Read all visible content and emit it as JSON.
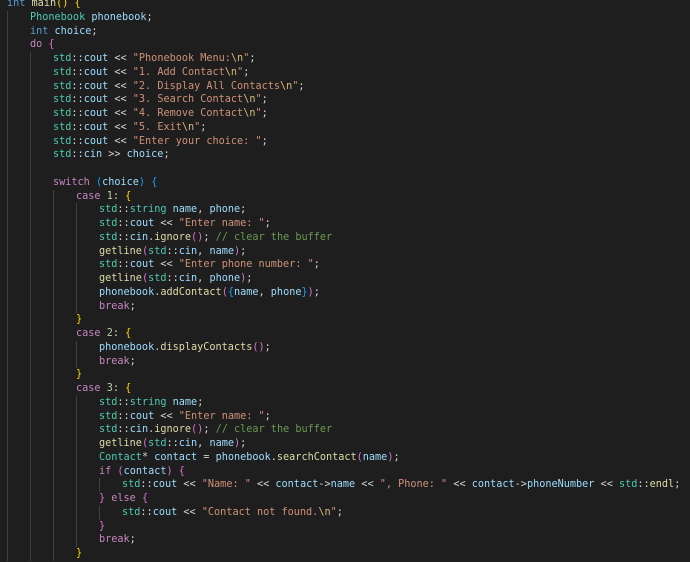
{
  "editor": {
    "language": "cpp",
    "theme": "dark",
    "lines": [
      {
        "indent": 0,
        "tokens": [
          [
            "int",
            "keyword"
          ],
          [
            " ",
            "plain"
          ],
          [
            "main",
            "func"
          ],
          [
            "()",
            "brace1"
          ],
          [
            " ",
            "plain"
          ],
          [
            "{",
            "brace1"
          ]
        ]
      },
      {
        "indent": 1,
        "tokens": [
          [
            "Phonebook",
            "type"
          ],
          [
            " ",
            "plain"
          ],
          [
            "phonebook",
            "var"
          ],
          [
            ";",
            "plain"
          ]
        ]
      },
      {
        "indent": 1,
        "tokens": [
          [
            "int",
            "keyword"
          ],
          [
            " ",
            "plain"
          ],
          [
            "choice",
            "var"
          ],
          [
            ";",
            "plain"
          ]
        ]
      },
      {
        "indent": 1,
        "tokens": [
          [
            "do",
            "control"
          ],
          [
            " ",
            "plain"
          ],
          [
            "{",
            "brace2"
          ]
        ]
      },
      {
        "indent": 2,
        "tokens": [
          [
            "std",
            "type"
          ],
          [
            "::",
            "op"
          ],
          [
            "cout",
            "var"
          ],
          [
            " << ",
            "op"
          ],
          [
            "\"Phonebook Menu:",
            "string"
          ],
          [
            "\\n",
            "escape"
          ],
          [
            "\"",
            "string"
          ],
          [
            ";",
            "plain"
          ]
        ]
      },
      {
        "indent": 2,
        "tokens": [
          [
            "std",
            "type"
          ],
          [
            "::",
            "op"
          ],
          [
            "cout",
            "var"
          ],
          [
            " << ",
            "op"
          ],
          [
            "\"1. Add Contact",
            "string"
          ],
          [
            "\\n",
            "escape"
          ],
          [
            "\"",
            "string"
          ],
          [
            ";",
            "plain"
          ]
        ]
      },
      {
        "indent": 2,
        "tokens": [
          [
            "std",
            "type"
          ],
          [
            "::",
            "op"
          ],
          [
            "cout",
            "var"
          ],
          [
            " << ",
            "op"
          ],
          [
            "\"2. Display All Contacts",
            "string"
          ],
          [
            "\\n",
            "escape"
          ],
          [
            "\"",
            "string"
          ],
          [
            ";",
            "plain"
          ]
        ]
      },
      {
        "indent": 2,
        "tokens": [
          [
            "std",
            "type"
          ],
          [
            "::",
            "op"
          ],
          [
            "cout",
            "var"
          ],
          [
            " << ",
            "op"
          ],
          [
            "\"3. Search Contact",
            "string"
          ],
          [
            "\\n",
            "escape"
          ],
          [
            "\"",
            "string"
          ],
          [
            ";",
            "plain"
          ]
        ]
      },
      {
        "indent": 2,
        "tokens": [
          [
            "std",
            "type"
          ],
          [
            "::",
            "op"
          ],
          [
            "cout",
            "var"
          ],
          [
            " << ",
            "op"
          ],
          [
            "\"4. Remove Contact",
            "string"
          ],
          [
            "\\n",
            "escape"
          ],
          [
            "\"",
            "string"
          ],
          [
            ";",
            "plain"
          ]
        ]
      },
      {
        "indent": 2,
        "tokens": [
          [
            "std",
            "type"
          ],
          [
            "::",
            "op"
          ],
          [
            "cout",
            "var"
          ],
          [
            " << ",
            "op"
          ],
          [
            "\"5. Exit",
            "string"
          ],
          [
            "\\n",
            "escape"
          ],
          [
            "\"",
            "string"
          ],
          [
            ";",
            "plain"
          ]
        ]
      },
      {
        "indent": 2,
        "tokens": [
          [
            "std",
            "type"
          ],
          [
            "::",
            "op"
          ],
          [
            "cout",
            "var"
          ],
          [
            " << ",
            "op"
          ],
          [
            "\"Enter your choice: \"",
            "string"
          ],
          [
            ";",
            "plain"
          ]
        ]
      },
      {
        "indent": 2,
        "tokens": [
          [
            "std",
            "type"
          ],
          [
            "::",
            "op"
          ],
          [
            "cin",
            "var"
          ],
          [
            " >> ",
            "op"
          ],
          [
            "choice",
            "var"
          ],
          [
            ";",
            "plain"
          ]
        ]
      },
      {
        "indent": 2,
        "tokens": []
      },
      {
        "indent": 2,
        "tokens": [
          [
            "switch",
            "control"
          ],
          [
            " ",
            "plain"
          ],
          [
            "(",
            "brace3"
          ],
          [
            "choice",
            "var"
          ],
          [
            ")",
            "brace3"
          ],
          [
            " ",
            "plain"
          ],
          [
            "{",
            "brace3"
          ]
        ]
      },
      {
        "indent": 3,
        "tokens": [
          [
            "case",
            "control"
          ],
          [
            " ",
            "plain"
          ],
          [
            "1",
            "number"
          ],
          [
            ":",
            "plain"
          ],
          [
            " ",
            "plain"
          ],
          [
            "{",
            "brace1"
          ]
        ]
      },
      {
        "indent": 4,
        "tokens": [
          [
            "std",
            "type"
          ],
          [
            "::",
            "op"
          ],
          [
            "string",
            "type"
          ],
          [
            " ",
            "plain"
          ],
          [
            "name",
            "var"
          ],
          [
            ", ",
            "plain"
          ],
          [
            "phone",
            "var"
          ],
          [
            ";",
            "plain"
          ]
        ]
      },
      {
        "indent": 4,
        "tokens": [
          [
            "std",
            "type"
          ],
          [
            "::",
            "op"
          ],
          [
            "cout",
            "var"
          ],
          [
            " << ",
            "op"
          ],
          [
            "\"Enter name: \"",
            "string"
          ],
          [
            ";",
            "plain"
          ]
        ]
      },
      {
        "indent": 4,
        "tokens": [
          [
            "std",
            "type"
          ],
          [
            "::",
            "op"
          ],
          [
            "cin",
            "var"
          ],
          [
            ".",
            "plain"
          ],
          [
            "ignore",
            "func"
          ],
          [
            "()",
            "brace2"
          ],
          [
            ";",
            "plain"
          ],
          [
            " ",
            "plain"
          ],
          [
            "// clear the buffer",
            "comment"
          ]
        ]
      },
      {
        "indent": 4,
        "tokens": [
          [
            "getline",
            "func"
          ],
          [
            "(",
            "brace2"
          ],
          [
            "std",
            "type"
          ],
          [
            "::",
            "op"
          ],
          [
            "cin",
            "var"
          ],
          [
            ", ",
            "plain"
          ],
          [
            "name",
            "var"
          ],
          [
            ")",
            "brace2"
          ],
          [
            ";",
            "plain"
          ]
        ]
      },
      {
        "indent": 4,
        "tokens": [
          [
            "std",
            "type"
          ],
          [
            "::",
            "op"
          ],
          [
            "cout",
            "var"
          ],
          [
            " << ",
            "op"
          ],
          [
            "\"Enter phone number: \"",
            "string"
          ],
          [
            ";",
            "plain"
          ]
        ]
      },
      {
        "indent": 4,
        "tokens": [
          [
            "getline",
            "func"
          ],
          [
            "(",
            "brace2"
          ],
          [
            "std",
            "type"
          ],
          [
            "::",
            "op"
          ],
          [
            "cin",
            "var"
          ],
          [
            ", ",
            "plain"
          ],
          [
            "phone",
            "var"
          ],
          [
            ")",
            "brace2"
          ],
          [
            ";",
            "plain"
          ]
        ]
      },
      {
        "indent": 4,
        "tokens": [
          [
            "phonebook",
            "var"
          ],
          [
            ".",
            "plain"
          ],
          [
            "addContact",
            "func"
          ],
          [
            "(",
            "brace2"
          ],
          [
            "{",
            "brace3"
          ],
          [
            "name",
            "var"
          ],
          [
            ", ",
            "plain"
          ],
          [
            "phone",
            "var"
          ],
          [
            "}",
            "brace3"
          ],
          [
            ")",
            "brace2"
          ],
          [
            ";",
            "plain"
          ]
        ]
      },
      {
        "indent": 4,
        "tokens": [
          [
            "break",
            "control"
          ],
          [
            ";",
            "plain"
          ]
        ]
      },
      {
        "indent": 3,
        "tokens": [
          [
            "}",
            "brace1"
          ]
        ]
      },
      {
        "indent": 3,
        "tokens": [
          [
            "case",
            "control"
          ],
          [
            " ",
            "plain"
          ],
          [
            "2",
            "number"
          ],
          [
            ":",
            "plain"
          ],
          [
            " ",
            "plain"
          ],
          [
            "{",
            "brace1"
          ]
        ]
      },
      {
        "indent": 4,
        "tokens": [
          [
            "phonebook",
            "var"
          ],
          [
            ".",
            "plain"
          ],
          [
            "displayContacts",
            "func"
          ],
          [
            "()",
            "brace2"
          ],
          [
            ";",
            "plain"
          ]
        ]
      },
      {
        "indent": 4,
        "tokens": [
          [
            "break",
            "control"
          ],
          [
            ";",
            "plain"
          ]
        ]
      },
      {
        "indent": 3,
        "tokens": [
          [
            "}",
            "brace1"
          ]
        ]
      },
      {
        "indent": 3,
        "tokens": [
          [
            "case",
            "control"
          ],
          [
            " ",
            "plain"
          ],
          [
            "3",
            "number"
          ],
          [
            ":",
            "plain"
          ],
          [
            " ",
            "plain"
          ],
          [
            "{",
            "brace1"
          ]
        ]
      },
      {
        "indent": 4,
        "tokens": [
          [
            "std",
            "type"
          ],
          [
            "::",
            "op"
          ],
          [
            "string",
            "type"
          ],
          [
            " ",
            "plain"
          ],
          [
            "name",
            "var"
          ],
          [
            ";",
            "plain"
          ]
        ]
      },
      {
        "indent": 4,
        "tokens": [
          [
            "std",
            "type"
          ],
          [
            "::",
            "op"
          ],
          [
            "cout",
            "var"
          ],
          [
            " << ",
            "op"
          ],
          [
            "\"Enter name: \"",
            "string"
          ],
          [
            ";",
            "plain"
          ]
        ]
      },
      {
        "indent": 4,
        "tokens": [
          [
            "std",
            "type"
          ],
          [
            "::",
            "op"
          ],
          [
            "cin",
            "var"
          ],
          [
            ".",
            "plain"
          ],
          [
            "ignore",
            "func"
          ],
          [
            "()",
            "brace2"
          ],
          [
            ";",
            "plain"
          ],
          [
            " ",
            "plain"
          ],
          [
            "// clear the buffer",
            "comment"
          ]
        ]
      },
      {
        "indent": 4,
        "tokens": [
          [
            "getline",
            "func"
          ],
          [
            "(",
            "brace2"
          ],
          [
            "std",
            "type"
          ],
          [
            "::",
            "op"
          ],
          [
            "cin",
            "var"
          ],
          [
            ", ",
            "plain"
          ],
          [
            "name",
            "var"
          ],
          [
            ")",
            "brace2"
          ],
          [
            ";",
            "plain"
          ]
        ]
      },
      {
        "indent": 4,
        "tokens": [
          [
            "Contact",
            "type"
          ],
          [
            "* ",
            "plain"
          ],
          [
            "contact",
            "var"
          ],
          [
            " = ",
            "op"
          ],
          [
            "phonebook",
            "var"
          ],
          [
            ".",
            "plain"
          ],
          [
            "searchContact",
            "func"
          ],
          [
            "(",
            "brace2"
          ],
          [
            "name",
            "var"
          ],
          [
            ")",
            "brace2"
          ],
          [
            ";",
            "plain"
          ]
        ]
      },
      {
        "indent": 4,
        "tokens": [
          [
            "if",
            "control"
          ],
          [
            " ",
            "plain"
          ],
          [
            "(",
            "brace2"
          ],
          [
            "contact",
            "var"
          ],
          [
            ")",
            "brace2"
          ],
          [
            " ",
            "plain"
          ],
          [
            "{",
            "brace2"
          ]
        ]
      },
      {
        "indent": 5,
        "tokens": [
          [
            "std",
            "type"
          ],
          [
            "::",
            "op"
          ],
          [
            "cout",
            "var"
          ],
          [
            " << ",
            "op"
          ],
          [
            "\"Name: \"",
            "string"
          ],
          [
            " << ",
            "op"
          ],
          [
            "contact",
            "var"
          ],
          [
            "->",
            "op"
          ],
          [
            "name",
            "var"
          ],
          [
            " << ",
            "op"
          ],
          [
            "\", Phone: \"",
            "string"
          ],
          [
            " << ",
            "op"
          ],
          [
            "contact",
            "var"
          ],
          [
            "->",
            "op"
          ],
          [
            "phoneNumber",
            "var"
          ],
          [
            " << ",
            "op"
          ],
          [
            "std",
            "type"
          ],
          [
            "::",
            "op"
          ],
          [
            "endl",
            "func"
          ],
          [
            ";",
            "plain"
          ]
        ]
      },
      {
        "indent": 4,
        "tokens": [
          [
            "}",
            "brace2"
          ],
          [
            " ",
            "plain"
          ],
          [
            "else",
            "control"
          ],
          [
            " ",
            "plain"
          ],
          [
            "{",
            "brace2"
          ]
        ]
      },
      {
        "indent": 5,
        "tokens": [
          [
            "std",
            "type"
          ],
          [
            "::",
            "op"
          ],
          [
            "cout",
            "var"
          ],
          [
            " << ",
            "op"
          ],
          [
            "\"Contact not found.",
            "string"
          ],
          [
            "\\n",
            "escape"
          ],
          [
            "\"",
            "string"
          ],
          [
            ";",
            "plain"
          ]
        ]
      },
      {
        "indent": 4,
        "tokens": [
          [
            "}",
            "brace2"
          ]
        ]
      },
      {
        "indent": 4,
        "tokens": [
          [
            "break",
            "control"
          ],
          [
            ";",
            "plain"
          ]
        ]
      },
      {
        "indent": 3,
        "tokens": [
          [
            "}",
            "brace1"
          ]
        ]
      }
    ]
  }
}
